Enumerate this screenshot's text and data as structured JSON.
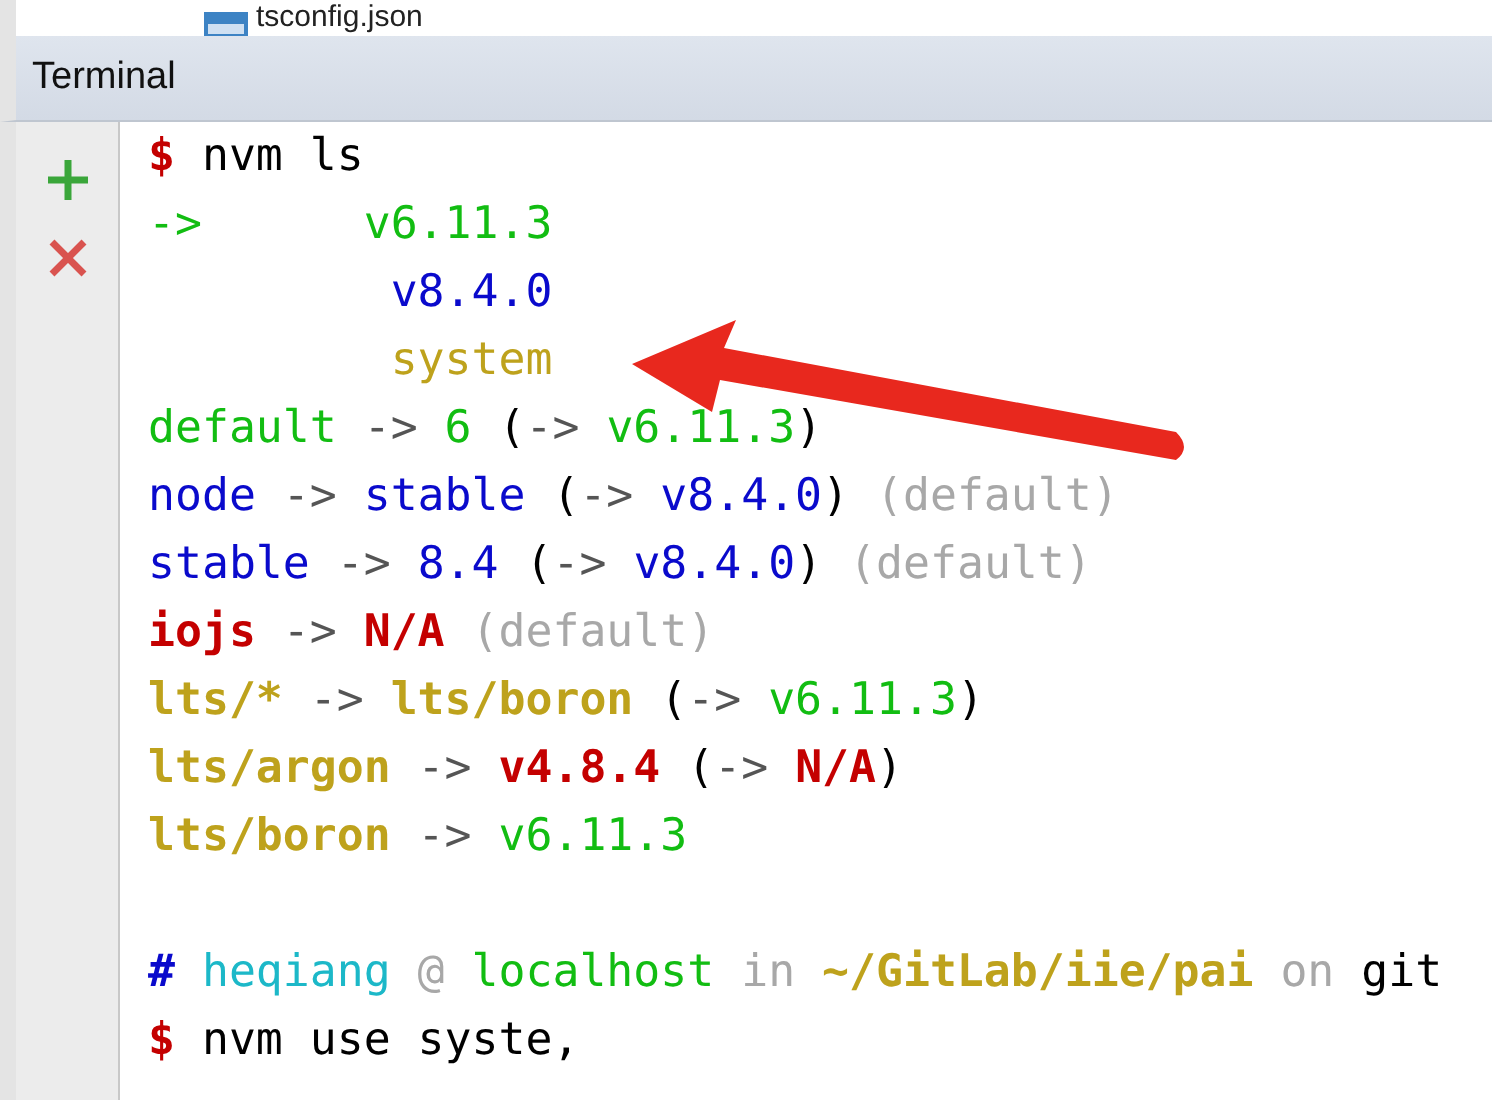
{
  "file_row": {
    "name": "tsconfig.json"
  },
  "panel": {
    "title": "Terminal"
  },
  "terminal": {
    "lines": [
      [
        {
          "kind": "red",
          "text": "$"
        },
        {
          "kind": "plain",
          "text": " nvm ls"
        }
      ],
      [
        {
          "kind": "green",
          "text": "->      v6.11.3"
        }
      ],
      [
        {
          "kind": "blue",
          "text": "         v8.4.0"
        }
      ],
      [
        {
          "kind": "yellow",
          "text": "         system"
        }
      ],
      [
        {
          "kind": "green",
          "text": "default"
        },
        {
          "kind": "arrow",
          "text": " -> "
        },
        {
          "kind": "green",
          "text": "6"
        },
        {
          "kind": "plain",
          "text": " ("
        },
        {
          "kind": "arrow",
          "text": "-> "
        },
        {
          "kind": "green",
          "text": "v6.11.3"
        },
        {
          "kind": "plain",
          "text": ")"
        }
      ],
      [
        {
          "kind": "blue",
          "text": "node"
        },
        {
          "kind": "arrow",
          "text": " -> "
        },
        {
          "kind": "blue",
          "text": "stable"
        },
        {
          "kind": "plain",
          "text": " ("
        },
        {
          "kind": "arrow",
          "text": "-> "
        },
        {
          "kind": "blue",
          "text": "v8.4.0"
        },
        {
          "kind": "plain",
          "text": ")"
        },
        {
          "kind": "gray",
          "text": " (default)"
        }
      ],
      [
        {
          "kind": "blue",
          "text": "stable"
        },
        {
          "kind": "arrow",
          "text": " -> "
        },
        {
          "kind": "blue",
          "text": "8.4"
        },
        {
          "kind": "plain",
          "text": " ("
        },
        {
          "kind": "arrow",
          "text": "-> "
        },
        {
          "kind": "blue",
          "text": "v8.4.0"
        },
        {
          "kind": "plain",
          "text": ")"
        },
        {
          "kind": "gray",
          "text": " (default)"
        }
      ],
      [
        {
          "kind": "red",
          "text": "iojs"
        },
        {
          "kind": "arrow",
          "text": " -> "
        },
        {
          "kind": "red",
          "text": "N/A"
        },
        {
          "kind": "gray",
          "text": " (default)"
        }
      ],
      [
        {
          "kind": "gold",
          "text": "lts/*"
        },
        {
          "kind": "arrow",
          "text": " -> "
        },
        {
          "kind": "gold",
          "text": "lts/boron"
        },
        {
          "kind": "plain",
          "text": " ("
        },
        {
          "kind": "arrow",
          "text": "-> "
        },
        {
          "kind": "green",
          "text": "v6.11.3"
        },
        {
          "kind": "plain",
          "text": ")"
        }
      ],
      [
        {
          "kind": "gold",
          "text": "lts/argon"
        },
        {
          "kind": "arrow",
          "text": " -> "
        },
        {
          "kind": "red",
          "text": "v4.8.4"
        },
        {
          "kind": "plain",
          "text": " ("
        },
        {
          "kind": "arrow",
          "text": "-> "
        },
        {
          "kind": "red",
          "text": "N/A"
        },
        {
          "kind": "plain",
          "text": ")"
        }
      ],
      [
        {
          "kind": "gold",
          "text": "lts/boron"
        },
        {
          "kind": "arrow",
          "text": " -> "
        },
        {
          "kind": "green",
          "text": "v6.11.3"
        }
      ],
      {
        "kind": "blank"
      },
      [
        {
          "kind": "hash",
          "text": "#"
        },
        {
          "kind": "cyan",
          "text": " heqiang"
        },
        {
          "kind": "gray",
          "text": " @ "
        },
        {
          "kind": "green",
          "text": "localhost"
        },
        {
          "kind": "gray",
          "text": " in "
        },
        {
          "kind": "gold",
          "text": "~/GitLab/iie/pai"
        },
        {
          "kind": "gray",
          "text": " on "
        },
        {
          "kind": "plain",
          "text": "git"
        }
      ],
      [
        {
          "kind": "red",
          "text": "$"
        },
        {
          "kind": "plain",
          "text": " nvm use syste,"
        }
      ]
    ]
  }
}
